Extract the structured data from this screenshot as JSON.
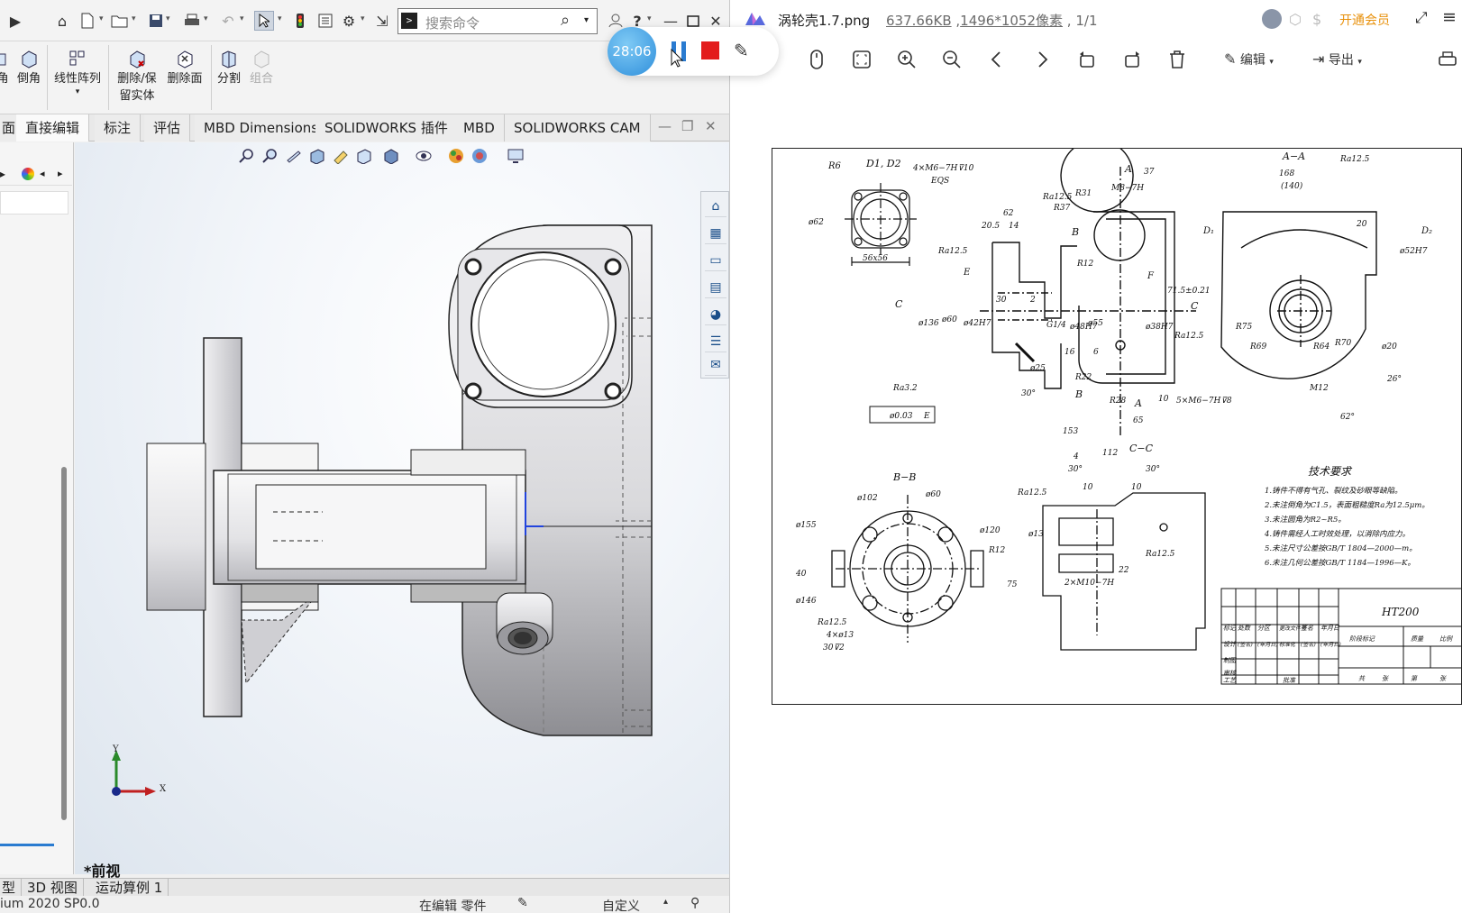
{
  "sw": {
    "search_placeholder": "搜索命令",
    "ribbon": {
      "fillet_partial": "角",
      "chamfer": "倒角",
      "linear_pattern": "线性阵列",
      "delete_keep_body_line1": "删除/保",
      "delete_keep_body_line2": "留实体",
      "delete_face": "删除面",
      "split": "分割",
      "combine": "组合"
    },
    "tabs": [
      "面",
      "直接编辑",
      "标注",
      "评估",
      "MBD Dimensions",
      "SOLIDWORKS 插件",
      "MBD",
      "SOLIDWORKS CAM"
    ],
    "active_tab_index": 1,
    "view_name": "*前视",
    "triad": {
      "x": "X",
      "y": "Y"
    },
    "bottom_tabs": [
      "型",
      "3D 视图",
      "运动算例 1"
    ],
    "status": {
      "version": "ium 2020 SP0.0",
      "state": "在编辑 零件",
      "units": "自定义"
    }
  },
  "recorder": {
    "timer": "28:06"
  },
  "viewer": {
    "filename": "涡轮壳1.7.png",
    "filesize": "637.66KB",
    "resolution": "1496*1052像素",
    "page": "1/1",
    "vip_label": "开通会员",
    "edit_label": "编辑",
    "export_label": "导出"
  },
  "drawing": {
    "section_aa": "A−A",
    "section_bb": "B−B",
    "section_cc": "C−C",
    "material": "HT200",
    "tech_title": "技术要求",
    "tech_notes": [
      "1.铸件不得有气孔、裂纹及砂眼等缺陷。",
      "2.未注倒角为C1.5，表面粗糙度Ra为12.5μm。",
      "3.未注圆角为R2~R5。",
      "4.铸件需经人工时效处理，以消除内应力。",
      "5.未注尺寸公差按GB/T 1804—2000—m。",
      "6.未注几何公差按GB/T 1184—1996—K。"
    ],
    "dims": {
      "r6": "R6",
      "d1d2": "D1, D2",
      "holes_top": "4×M6−7H⊽10",
      "eqs": "EQS",
      "d62": "ø62",
      "sq": "56x56",
      "ra125": "Ra12.5",
      "r31": "R31",
      "r37": "R37",
      "m8": "M8−7H",
      "d37": "37",
      "d205": "20.5",
      "d14": "14",
      "d62b": "62",
      "ra63": "Ra6.3",
      "r12": "R12",
      "d715": "71.5±0.21",
      "d136": "ø136",
      "d60": "ø60",
      "d42h7": "ø42H7",
      "d30": "30",
      "d2": "2",
      "g14": "G1/4",
      "d48h7": "ø48H7",
      "d55": "ø55",
      "d38h7": "ø38H7",
      "d16": "16",
      "d6": "6",
      "d25": "ø25",
      "r22": "R22",
      "r28": "R28",
      "a30": "30°",
      "ra32": "Ra3.2",
      "tol": "ø0.03",
      "datum_e": "E",
      "d65": "65",
      "d10": "10",
      "d153": "153",
      "m6b": "5×M6−7H⊽8",
      "d168": "168",
      "d140": "(140)",
      "d20": "20",
      "d52h7": "ø52H7",
      "r75": "R75",
      "r69": "R69",
      "r64": "R64",
      "r70": "R70",
      "d20b": "ø20",
      "m12": "M12",
      "a26": "26°",
      "a62": "62°",
      "d112": "112",
      "d4": "4",
      "d102": "ø102",
      "d60b": "ø60",
      "d155": "ø155",
      "d120": "ø120",
      "d146": "ø146",
      "d40": "40",
      "d13": "4×ø13",
      "d302": "30⊽2",
      "d13b": "ø13",
      "m10": "2×M10−7H",
      "d22": "22",
      "d75": "75",
      "c_lbl": "C",
      "b_lbl": "B",
      "a_lbl": "A",
      "f_lbl": "F",
      "e_lbl": "E"
    },
    "title_block": {
      "row1": [
        "标记",
        "处数",
        "分区",
        "更改文件号",
        "签名",
        "年月日"
      ],
      "row2": [
        "设计",
        "(签名)",
        "(年月日)",
        "标准化",
        "(签名)",
        "(年月日)"
      ],
      "row3": [
        "制图"
      ],
      "row4": [
        "审核"
      ],
      "row5": [
        "工艺",
        "批准"
      ],
      "right_row": [
        "阶段标记",
        "质量",
        "比例"
      ],
      "right_row2": [
        "共",
        "张",
        "第",
        "张"
      ]
    }
  }
}
